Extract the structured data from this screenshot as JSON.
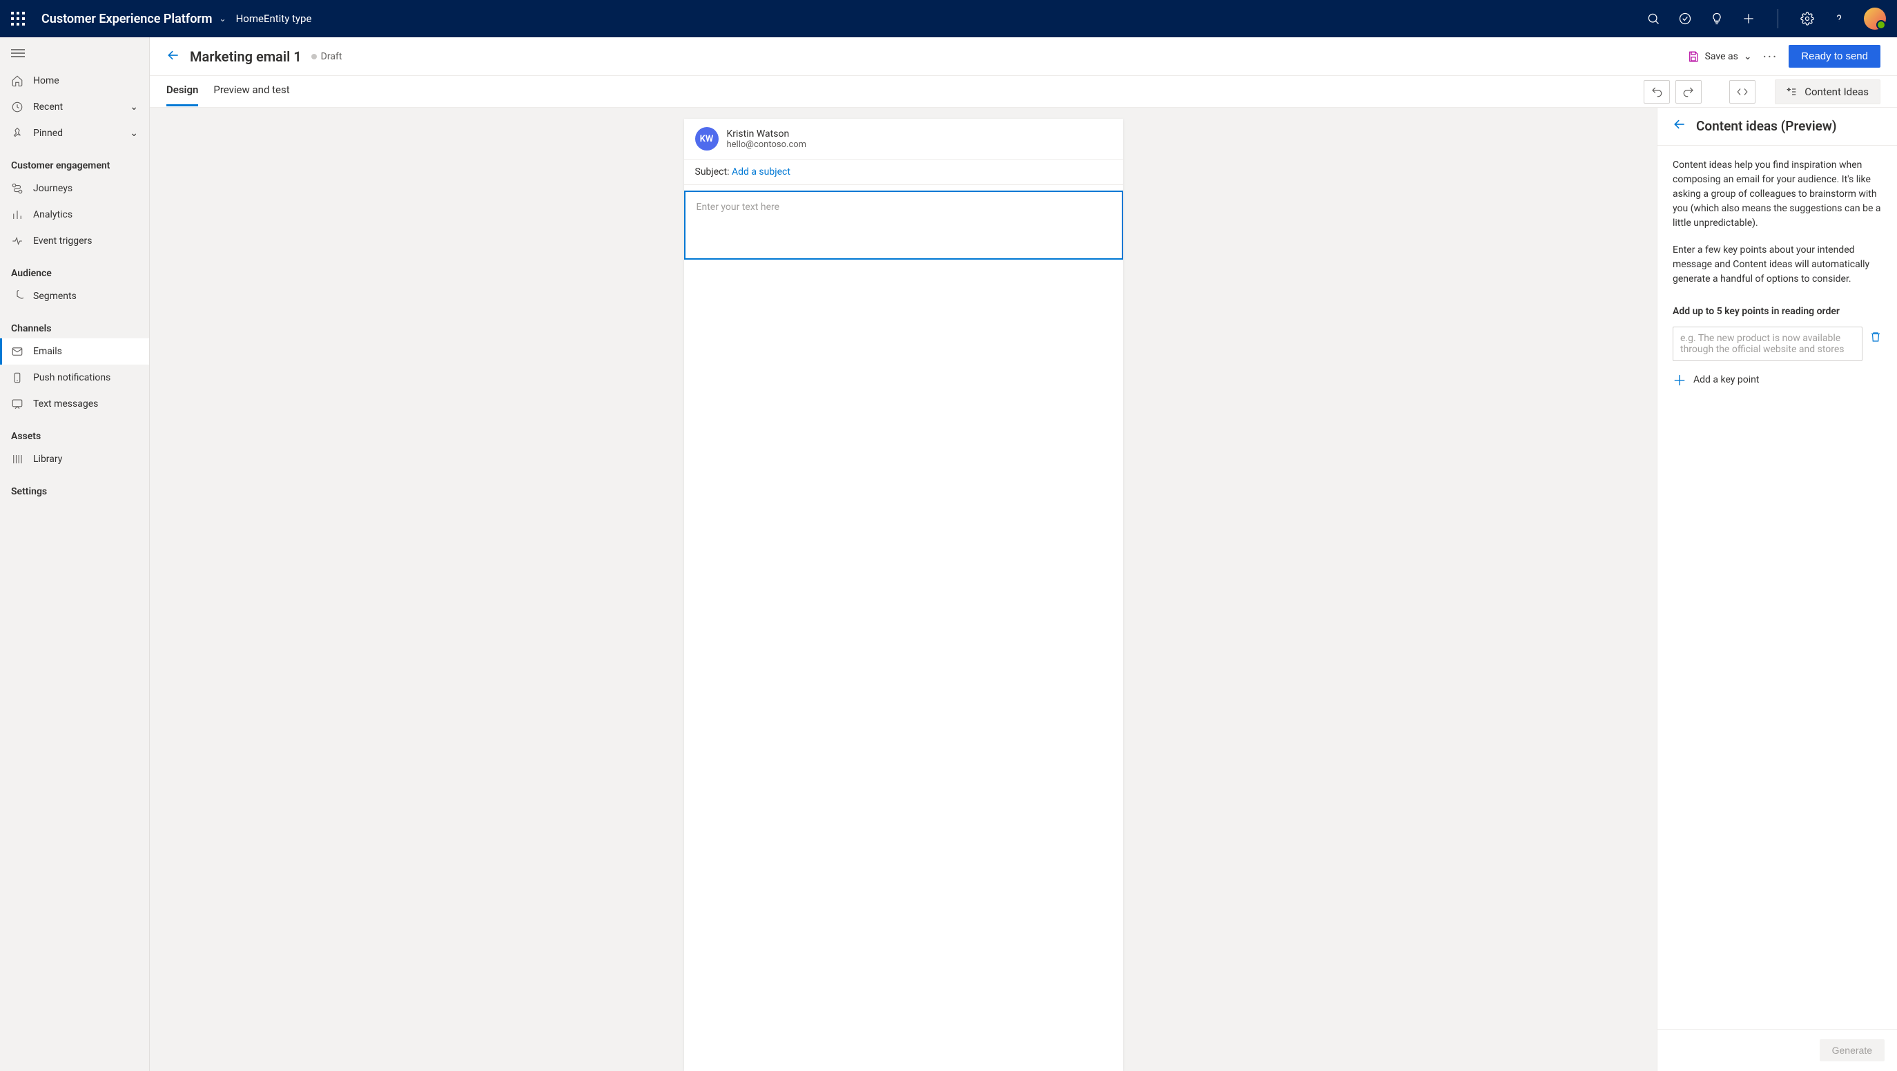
{
  "header": {
    "app_title": "Customer Experience Platform",
    "breadcrumb_home": "Home",
    "breadcrumb_entity": "Entity type"
  },
  "sidebar": {
    "home": "Home",
    "recent": "Recent",
    "pinned": "Pinned",
    "sections": {
      "engagement_label": "Customer engagement",
      "journeys": "Journeys",
      "analytics": "Analytics",
      "triggers": "Event triggers",
      "audience_label": "Audience",
      "segments": "Segments",
      "channels_label": "Channels",
      "emails": "Emails",
      "push": "Push notifications",
      "text": "Text messages",
      "assets_label": "Assets",
      "library": "Library",
      "settings_label": "Settings"
    }
  },
  "page": {
    "title": "Marketing email 1",
    "status": "Draft",
    "save_as": "Save as",
    "cta": "Ready to send"
  },
  "tabs": {
    "design": "Design",
    "preview": "Preview and test",
    "content_ideas_btn": "Content Ideas"
  },
  "email": {
    "sender_initials": "KW",
    "sender_name": "Kristin Watson",
    "sender_email": "hello@contoso.com",
    "subject_label": "Subject: ",
    "subject_link": "Add a subject",
    "body_placeholder": "Enter your text here"
  },
  "panel": {
    "title": "Content ideas (Preview)",
    "para1": "Content ideas help you find inspiration when composing an email for your audience. It's like asking a group of colleagues to brainstorm with you (which also means the suggestions can be a little unpredictable).",
    "para2": "Enter a few key points about your intended message and Content ideas will automatically generate a handful of options to consider.",
    "kp_label": "Add up to 5 key points in reading order",
    "kp_placeholder": "e.g. The new product is now available through the official website and stores",
    "add_kp": "Add a key point",
    "generate": "Generate"
  }
}
